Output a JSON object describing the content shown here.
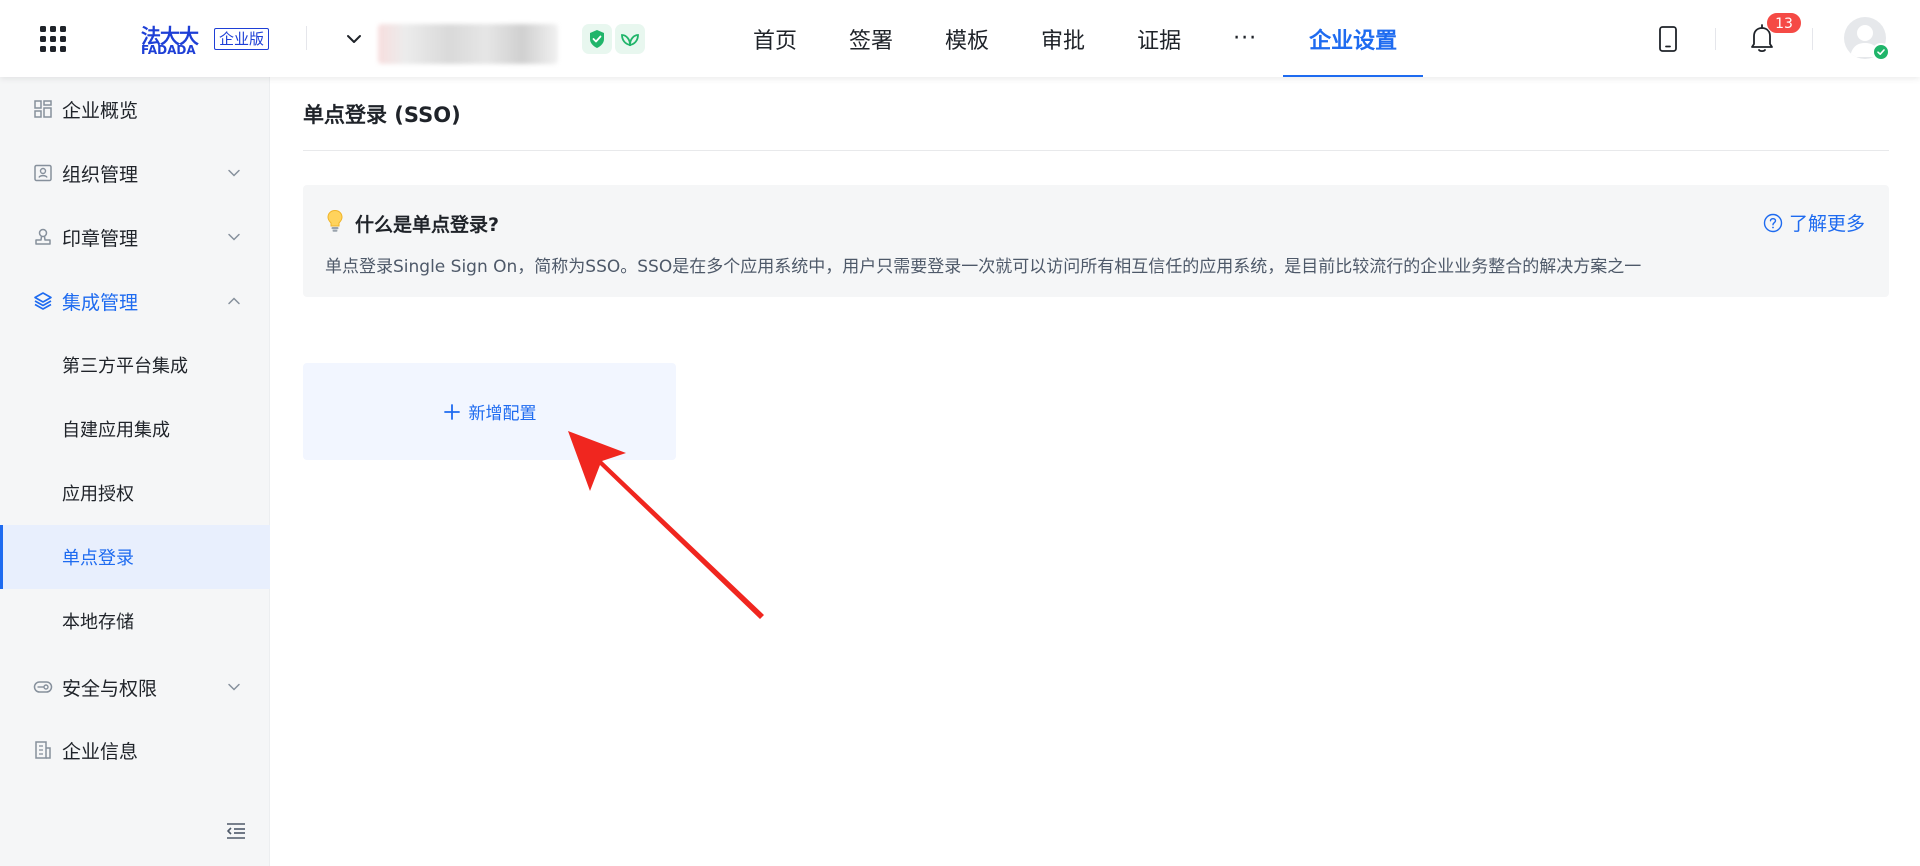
{
  "header": {
    "logo_text": "法大大",
    "logo_en": "FADADA",
    "edition_badge": "企业版",
    "org_name": "████████",
    "nav": [
      {
        "label": "首页"
      },
      {
        "label": "签署"
      },
      {
        "label": "模板"
      },
      {
        "label": "审批"
      },
      {
        "label": "证据"
      },
      {
        "label": "···"
      },
      {
        "label": "企业设置",
        "active": true
      }
    ],
    "notification_count": "13"
  },
  "sidebar": {
    "items": [
      {
        "label": "企业概览",
        "icon": "dashboard-icon"
      },
      {
        "label": "组织管理",
        "icon": "org-card-icon"
      },
      {
        "label": "印章管理",
        "icon": "seal-icon"
      },
      {
        "label": "集成管理",
        "icon": "layers-icon",
        "expanded": true
      },
      {
        "label": "安全与权限",
        "icon": "key-icon"
      },
      {
        "label": "企业信息",
        "icon": "building-icon"
      }
    ],
    "sub_items": [
      {
        "label": "第三方平台集成"
      },
      {
        "label": "自建应用集成"
      },
      {
        "label": "应用授权"
      },
      {
        "label": "单点登录",
        "active": true
      },
      {
        "label": "本地存储"
      }
    ]
  },
  "main": {
    "title": "单点登录 (SSO)",
    "info": {
      "question": "什么是单点登录?",
      "description": "单点登录Single Sign On，简称为SSO。SSO是在多个应用系统中，用户只需要登录一次就可以访问所有相互信任的应用系统，是目前比较流行的企业业务整合的解决方案之一",
      "learn_more": "了解更多"
    },
    "add_config_label": "新增配置"
  },
  "colors": {
    "accent": "#1e6bf0",
    "brand": "#1e3fd6",
    "badge": "#f54a45",
    "annotation_arrow": "#f0261f"
  }
}
